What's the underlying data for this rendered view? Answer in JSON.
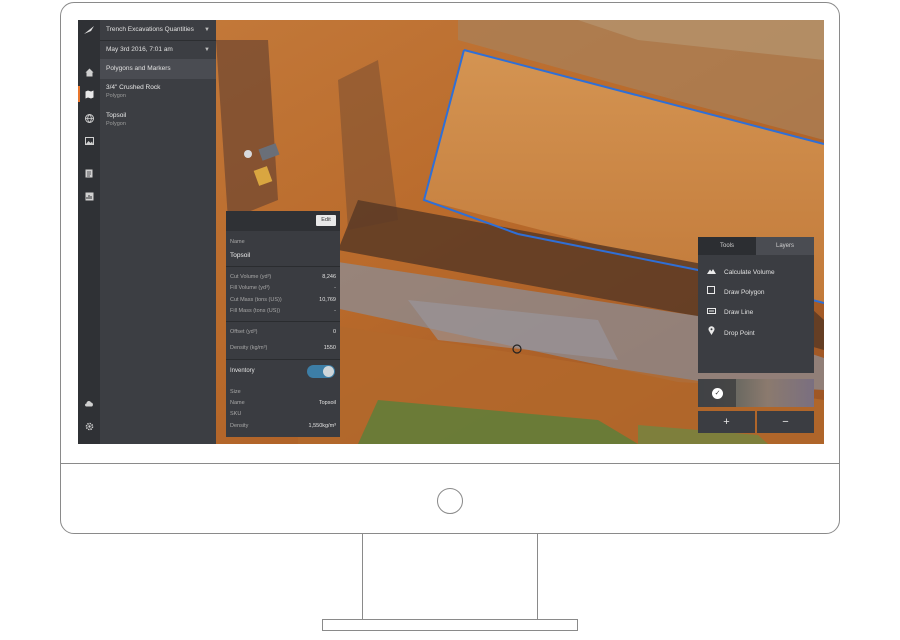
{
  "app": {
    "project_dropdown": "Trench Excavations Quantities",
    "date_dropdown": "May 3rd 2016, 7:01 am",
    "section_title": "Polygons and Markers"
  },
  "layers": [
    {
      "name": "3/4\" Crushed Rock",
      "type": "Polygon"
    },
    {
      "name": "Topsoil",
      "type": "Polygon"
    }
  ],
  "sidebar_icons": [
    "home-icon",
    "map-icon",
    "globe-icon",
    "image-icon",
    "report-icon",
    "chart-icon",
    "cloud-upload-icon",
    "settings-icon"
  ],
  "details": {
    "edit_label": "Edit",
    "name_label": "Name",
    "name_value": "Topsoil",
    "rows": [
      {
        "label": "Cut Volume (yd³)",
        "value": "8,246"
      },
      {
        "label": "Fill Volume (yd³)",
        "value": "-"
      },
      {
        "label": "Cut Mass (tons (US))",
        "value": "10,769"
      },
      {
        "label": "Fill Mass (tons (US))",
        "value": "-"
      }
    ],
    "offset_label": "Offset (yd³)",
    "offset_value": "0",
    "density_label": "Density (kg/m³)",
    "density_value": "1550",
    "inventory_label": "Inventory",
    "inventory_on": true,
    "size_label": "Size",
    "inv_name_label": "Name",
    "inv_name_value": "Topsoil",
    "sku_label": "SKU",
    "inv_density_label": "Density",
    "inv_density_value": "1,550kg/m³"
  },
  "tools": {
    "tab_tools": "Tools",
    "tab_layers": "Layers",
    "items": [
      {
        "label": "Calculate Volume",
        "icon": "mountain-icon"
      },
      {
        "label": "Draw Polygon",
        "icon": "polygon-icon"
      },
      {
        "label": "Draw Line",
        "icon": "line-icon"
      },
      {
        "label": "Drop Point",
        "icon": "pin-icon"
      }
    ]
  },
  "zoom": {
    "in": "+",
    "out": "−"
  },
  "colors": {
    "polygon_outline": "#2f6fd6",
    "toggle_on": "#3d7ea6",
    "active_accent": "#e8762d"
  }
}
